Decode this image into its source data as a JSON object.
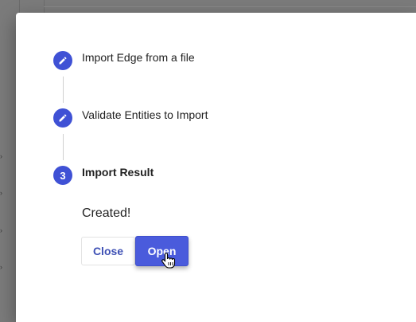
{
  "stepper": {
    "steps": [
      {
        "label": "Import Edge from a file",
        "icon": "pencil-icon",
        "state": "completed"
      },
      {
        "label": "Validate Entities to Import",
        "icon": "pencil-icon",
        "state": "completed"
      },
      {
        "label": "Import Result",
        "number": "3",
        "state": "active"
      }
    ]
  },
  "result": {
    "message": "Created!"
  },
  "actions": {
    "close_label": "Close",
    "open_label": "Open"
  },
  "colors": {
    "accent": "#3f51d5",
    "accent_text": "#3f51b5",
    "overlay": "#7b7b7b"
  },
  "cursor": "hand-pointer-icon"
}
